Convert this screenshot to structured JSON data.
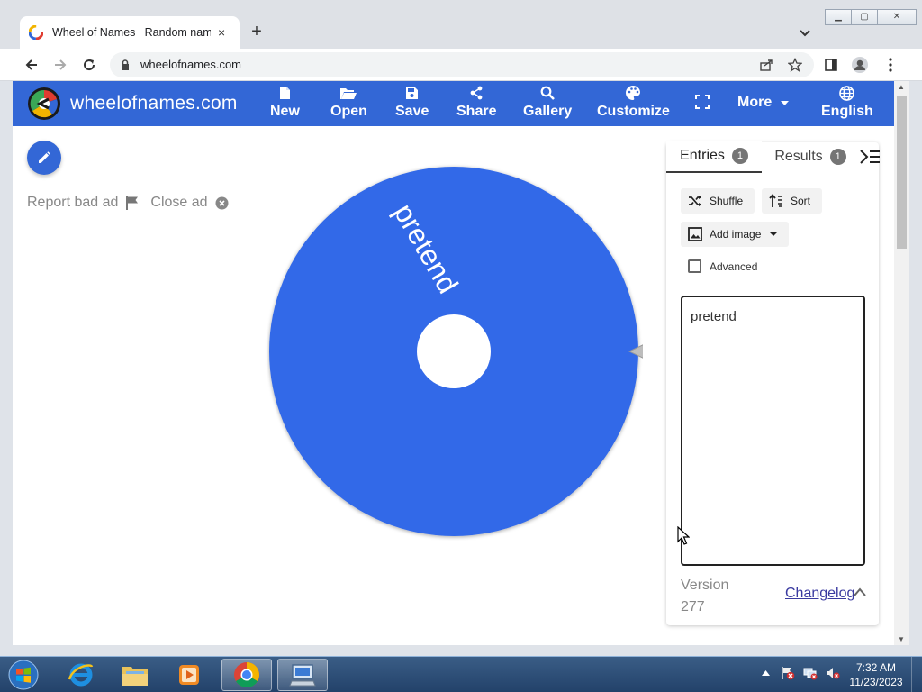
{
  "browser": {
    "tab_title": "Wheel of Names | Random name",
    "new_tab_symbol": "+",
    "close_symbol": "×",
    "url": "wheelofnames.com"
  },
  "app": {
    "brand": "wheelofnames.com",
    "menu": {
      "new": "New",
      "open": "Open",
      "save": "Save",
      "share": "Share",
      "gallery": "Gallery",
      "customize": "Customize",
      "more": "More",
      "language": "English"
    },
    "colors": {
      "primary": "#3367d6",
      "wheel_segment": "#3369e8"
    }
  },
  "ad": {
    "report": "Report bad ad",
    "close": "Close ad"
  },
  "wheel": {
    "entries": [
      "pretend"
    ]
  },
  "sidebar": {
    "tab_entries": "Entries",
    "entries_count": "1",
    "tab_results": "Results",
    "results_count": "1",
    "shuffle": "Shuffle",
    "sort": "Sort",
    "add_image": "Add image",
    "advanced": "Advanced",
    "textarea_value": "pretend",
    "version_label": "Version",
    "version_number": "277",
    "changelog": "Changelog"
  },
  "taskbar": {
    "time": "7:32 AM",
    "date": "11/23/2023"
  }
}
